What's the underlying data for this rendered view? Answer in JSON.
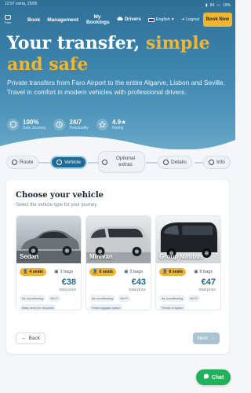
{
  "status_bar": {
    "time": "12:57",
    "date": "ceirta, 25/05",
    "signal": "84",
    "battery": "19%"
  },
  "nav": {
    "logo_text": "Faro",
    "items": [
      "Book",
      "Management",
      "My Bookings"
    ],
    "drivers": "Drivers",
    "language": "English",
    "logout": "Logout",
    "book_now": "Book Now"
  },
  "hero": {
    "title_line1": "Your transfer,",
    "title_accent1": "simple",
    "title_accent2": "and safe",
    "subtitle": "Private transfers from Faro Airport to the entire Algarve, Lisbon and Seville. Travel in comfort in modern vehicles with professional drivers.",
    "stats": [
      {
        "value": "100%",
        "label": "Safe Journey",
        "icon": "shield-icon"
      },
      {
        "value": "24/7",
        "label": "Punctuality",
        "icon": "clock-icon"
      },
      {
        "value": "4.9★",
        "label": "Rating",
        "icon": "star-icon"
      }
    ]
  },
  "stepper": {
    "steps": [
      {
        "label": "Route",
        "state": "done"
      },
      {
        "label": "Vehicle",
        "state": "active"
      },
      {
        "label": "Optional extras",
        "state": "pending"
      },
      {
        "label": "Details",
        "state": "pending"
      },
      {
        "label": "Info",
        "state": "pending"
      }
    ]
  },
  "vehicle_section": {
    "title": "Choose your vehicle",
    "subtitle": "Select the vehicle type for your journey",
    "vehicles": [
      {
        "name": "Sedan",
        "seats": "4 seats",
        "bags": "3 bags",
        "price": "€38",
        "price_label": "total price",
        "features": [
          "Air conditioning",
          "Wi-Fi",
          "Baby seat (on request)"
        ]
      },
      {
        "name": "Minivan",
        "seats": "6 seats",
        "bags": "5 bags",
        "price": "€43",
        "price_label": "total price",
        "features": [
          "Air conditioning",
          "Wi-Fi",
          "Extra luggage space"
        ]
      },
      {
        "name": "Group Minibus",
        "seats": "8 seats",
        "bags": "8 bags",
        "price": "€47",
        "price_label": "total price",
        "features": [
          "Air conditioning",
          "Wi-Fi",
          "Plenty of space"
        ]
      }
    ],
    "back_label": "Back",
    "next_label": "Next"
  },
  "chat": {
    "label": "Chat"
  },
  "colors": {
    "brand": "#1f6b93",
    "accent": "#f0b533",
    "chat": "#20b15a"
  }
}
